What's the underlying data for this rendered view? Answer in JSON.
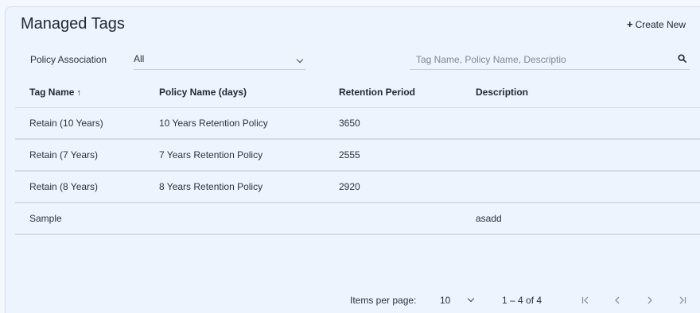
{
  "header": {
    "title": "Managed Tags",
    "create_label": "Create New"
  },
  "filter": {
    "label": "Policy Association",
    "selected": "All"
  },
  "search": {
    "placeholder": "Tag Name, Policy Name, Descriptio"
  },
  "table": {
    "columns": [
      "Tag Name",
      "Policy Name (days)",
      "Retention Period",
      "Description"
    ],
    "sort_indicator": "↑",
    "rows": [
      [
        "Retain (10 Years)",
        "10 Years Retention Policy",
        "3650",
        ""
      ],
      [
        "Retain (7 Years)",
        "7 Years Retention Policy",
        "2555",
        ""
      ],
      [
        "Retain (8 Years)",
        "8 Years Retention Policy",
        "2920",
        ""
      ],
      [
        "Sample",
        "",
        "",
        "asadd"
      ]
    ]
  },
  "paginator": {
    "items_label": "Items per page:",
    "page_size": "10",
    "range": "1 – 4 of 4"
  },
  "icons": {
    "create": "plus-icon",
    "search": "search-icon",
    "first": "first-page-icon",
    "prev": "prev-page-icon",
    "next": "next-page-icon",
    "last": "last-page-icon"
  }
}
